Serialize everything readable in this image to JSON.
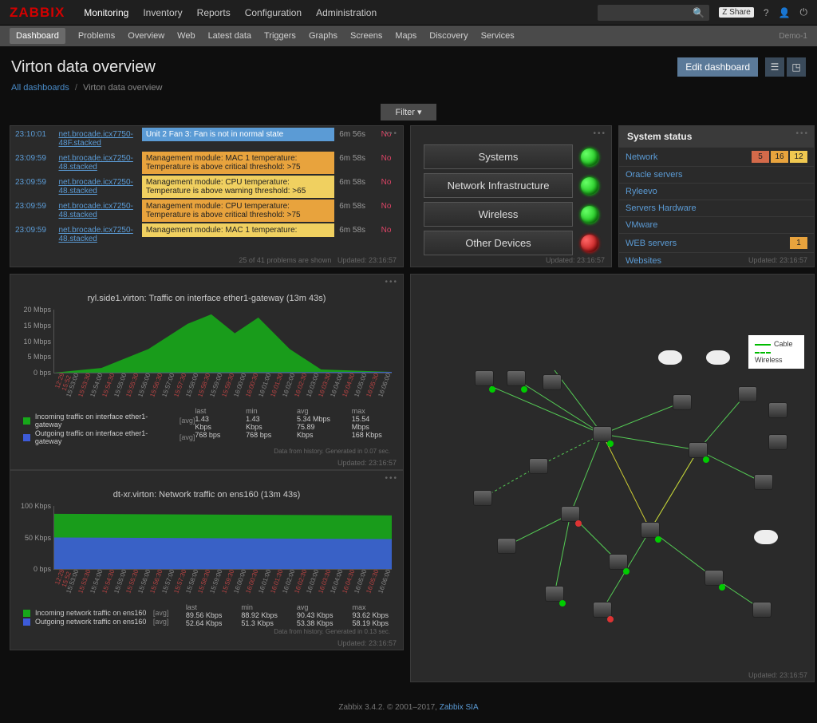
{
  "logo": "ZABBIX",
  "topnav": [
    "Monitoring",
    "Inventory",
    "Reports",
    "Configuration",
    "Administration"
  ],
  "topnav_active": 0,
  "share": "Share",
  "subnav": [
    "Dashboard",
    "Problems",
    "Overview",
    "Web",
    "Latest data",
    "Triggers",
    "Graphs",
    "Screens",
    "Maps",
    "Discovery",
    "Services"
  ],
  "subnav_active": 0,
  "demo": "Demo-1",
  "page_title": "Virton data overview",
  "edit_dashboard": "Edit dashboard",
  "breadcrumb": {
    "root": "All dashboards",
    "here": "Virton data overview"
  },
  "filter": "Filter",
  "updated_label": "Updated: 23:16:57",
  "problems": {
    "rows": [
      {
        "time": "23:10:01",
        "host": "net.brocade.icx7750-48F.stacked",
        "msg": "Unit 2 Fan 3: Fan is not in normal state",
        "sev": "info",
        "dur": "6m 56s",
        "ack": "No"
      },
      {
        "time": "23:09:59",
        "host": "net.brocade.icx7250-48.stacked",
        "msg": "Management module: MAC 1 temperature: Temperature is above critical threshold: >75",
        "sev": "avg",
        "dur": "6m 58s",
        "ack": "No"
      },
      {
        "time": "23:09:59",
        "host": "net.brocade.icx7250-48.stacked",
        "msg": "Management module: CPU temperature: Temperature is above warning threshold: >65",
        "sev": "warn",
        "dur": "6m 58s",
        "ack": "No"
      },
      {
        "time": "23:09:59",
        "host": "net.brocade.icx7250-48.stacked",
        "msg": "Management module: CPU temperature: Temperature is above critical threshold: >75",
        "sev": "avg",
        "dur": "6m 58s",
        "ack": "No"
      },
      {
        "time": "23:09:59",
        "host": "net.brocade.icx7250-48.stacked",
        "msg": "Management module: MAC 1 temperature:",
        "sev": "warn",
        "dur": "6m 58s",
        "ack": "No"
      }
    ],
    "footer": "25 of 41 problems are shown"
  },
  "hostgroups": [
    {
      "label": "Systems",
      "status": "green"
    },
    {
      "label": "Network Infrastructure",
      "status": "green"
    },
    {
      "label": "Wireless",
      "status": "green"
    },
    {
      "label": "Other Devices",
      "status": "red"
    }
  ],
  "system_status": {
    "title": "System status",
    "rows": [
      {
        "name": "Network",
        "badges": [
          {
            "v": "5",
            "c": "high"
          },
          {
            "v": "16",
            "c": "avg"
          },
          {
            "v": "12",
            "c": "warn"
          }
        ]
      },
      {
        "name": "Oracle servers",
        "badges": []
      },
      {
        "name": "Ryleevo",
        "badges": []
      },
      {
        "name": "Servers Hardware",
        "badges": []
      },
      {
        "name": "VMware",
        "badges": []
      },
      {
        "name": "WEB servers",
        "badges": [
          {
            "v": "1",
            "c": "avg"
          }
        ]
      },
      {
        "name": "Websites",
        "badges": []
      }
    ]
  },
  "chart_data": [
    {
      "type": "area",
      "title": "ryl.side1.virton: Traffic on interface ether1-gateway (13m 43s)",
      "ylabel": "",
      "yticks": [
        "0 bps",
        "5 Mbps",
        "10 Mbps",
        "15 Mbps",
        "20 Mbps"
      ],
      "xticks": [
        "12:29 15:52",
        "15:53:00",
        "15:53:30",
        "15:54:00",
        "15:54:30",
        "15:55:00",
        "15:55:30",
        "15:56:00",
        "15:56:30",
        "15:57:00",
        "15:57:30",
        "15:58:00",
        "15:58:30",
        "15:59:00",
        "15:59:30",
        "16:00:00",
        "16:00:30",
        "16:01:00",
        "16:01:30",
        "16:02:00",
        "16:02:30",
        "16:03:00",
        "16:03:30",
        "16:04:00",
        "16:04:30",
        "16:05:00",
        "16:05:30",
        "16:06:00"
      ],
      "series": [
        {
          "name": "Incoming traffic on interface ether1-gateway",
          "agg": "[avg]",
          "color": "#17a81a",
          "stats": {
            "last": "1.43 Kbps",
            "min": "1.43 Kbps",
            "avg": "5.34 Mbps",
            "max": "15.54 Mbps"
          }
        },
        {
          "name": "Outgoing traffic on interface ether1-gateway",
          "agg": "[avg]",
          "color": "#3d5bd9",
          "stats": {
            "last": "768 bps",
            "min": "768 bps",
            "avg": "75.89 Kbps",
            "max": "168 Kbps"
          }
        }
      ],
      "note": "Data from history. Generated in 0.07 sec."
    },
    {
      "type": "area",
      "title": "dt-xr.virton: Network traffic on ens160 (13m 43s)",
      "ylabel": "",
      "yticks": [
        "0 bps",
        "50 Kbps",
        "100 Kbps"
      ],
      "xticks": [
        "12:29 15:52",
        "15:53:00",
        "15:53:30",
        "15:54:00",
        "15:54:30",
        "15:55:00",
        "15:55:30",
        "15:56:00",
        "15:56:30",
        "15:57:00",
        "15:57:30",
        "15:58:00",
        "15:58:30",
        "15:59:00",
        "15:59:30",
        "16:00:00",
        "16:00:30",
        "16:01:00",
        "16:01:30",
        "16:02:00",
        "16:02:30",
        "16:03:00",
        "16:03:30",
        "16:04:00",
        "16:04:30",
        "16:05:00",
        "16:05:30",
        "16:06:00"
      ],
      "series": [
        {
          "name": "Incoming network traffic on ens160",
          "agg": "[avg]",
          "color": "#17a81a",
          "stats": {
            "last": "89.56 Kbps",
            "min": "88.92 Kbps",
            "avg": "90.43 Kbps",
            "max": "93.62 Kbps"
          }
        },
        {
          "name": "Outgoing network traffic on ens160",
          "agg": "[avg]",
          "color": "#3d5bd9",
          "stats": {
            "last": "52.64 Kbps",
            "min": "51.3 Kbps",
            "avg": "53.38 Kbps",
            "max": "58.19 Kbps"
          }
        }
      ],
      "note": "Data from history. Generated in 0.13 sec."
    }
  ],
  "map_legend": {
    "cable": "Cable",
    "wireless": "Wireless"
  },
  "footer": {
    "text": "Zabbix 3.4.2. © 2001–2017, ",
    "link": "Zabbix SIA"
  }
}
